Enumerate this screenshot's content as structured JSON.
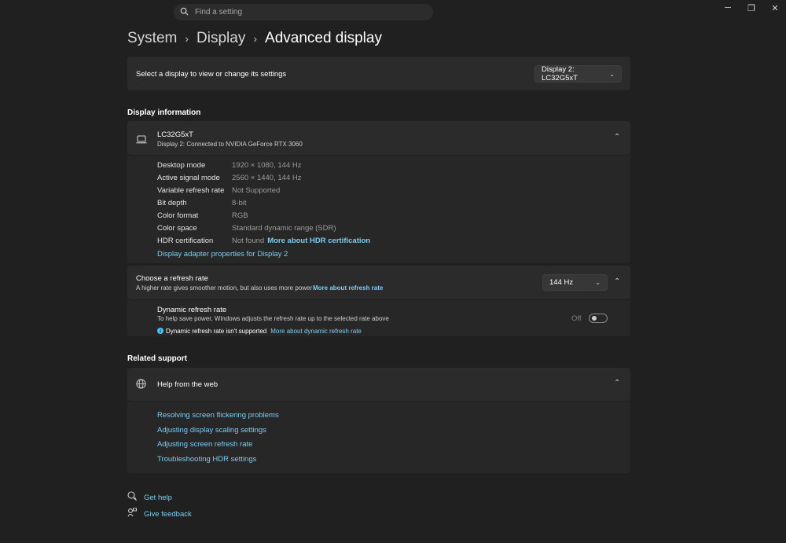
{
  "titlebar": {
    "search_placeholder": "Find a setting",
    "minimize": "─",
    "restore": "❐",
    "close": "✕"
  },
  "breadcrumb": {
    "items": [
      "System",
      "Display"
    ],
    "current": "Advanced display"
  },
  "select_display": {
    "label": "Select a display to view or change its settings",
    "dropdown_value": "Display 2: LC32G5xT"
  },
  "display_information": {
    "section_title": "Display information",
    "monitor_name": "LC32G5xT",
    "monitor_sub": "Display 2: Connected to NVIDIA GeForce RTX 3060",
    "rows": [
      {
        "key": "Desktop mode",
        "value": "1920 × 1080, 144 Hz"
      },
      {
        "key": "Active signal mode",
        "value": "2560 × 1440, 144 Hz"
      },
      {
        "key": "Variable refresh rate",
        "value": "Not Supported"
      },
      {
        "key": "Bit depth",
        "value": "8-bit"
      },
      {
        "key": "Color format",
        "value": "RGB"
      },
      {
        "key": "Color space",
        "value": "Standard dynamic range (SDR)"
      }
    ],
    "hdr": {
      "key": "HDR certification",
      "value": "Not found",
      "link": "More about HDR certification"
    },
    "adapter_link": "Display adapter properties for Display 2"
  },
  "refresh_rate": {
    "title": "Choose a refresh rate",
    "subtitle": "A higher rate gives smoother motion, but also uses more power",
    "link": "More about refresh rate",
    "dropdown_value": "144 Hz",
    "dynamic": {
      "title": "Dynamic refresh rate",
      "subtitle": "To help save power, Windows adjusts the refresh rate up to the selected rate above",
      "warning": "Dynamic refresh rate isn't supported",
      "link": "More about dynamic refresh rate",
      "toggle_label": "Off",
      "toggle_on": false
    }
  },
  "related_support": {
    "section_title": "Related support",
    "help_title": "Help from the web",
    "links": [
      "Resolving screen flickering problems",
      "Adjusting display scaling settings",
      "Adjusting screen refresh rate",
      "Troubleshooting HDR settings"
    ]
  },
  "footer": {
    "get_help": "Get help",
    "give_feedback": "Give feedback"
  },
  "colors": {
    "background": "#202020",
    "card": "#2b2b2b",
    "accent_link": "#7ccdf2",
    "info_icon": "#4cc2ff"
  }
}
